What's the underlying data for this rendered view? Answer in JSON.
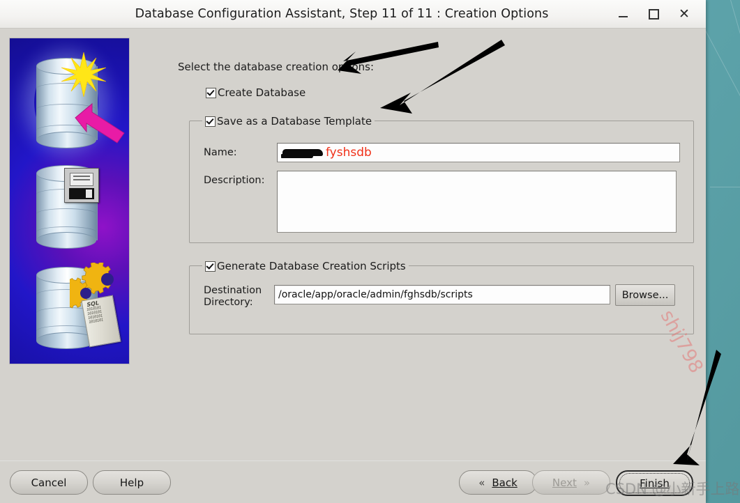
{
  "window": {
    "title": "Database Configuration Assistant, Step 11 of 11 : Creation Options",
    "minimize_label": "Minimize",
    "maximize_label": "Maximize",
    "close_label": "Close",
    "bg_color": "#d4d2cd",
    "titlebar_color": "#f4f3f1"
  },
  "desktop": {
    "bg_color": "#5aa3ac"
  },
  "sidepanel": {
    "alt": "Oracle database creation illustration",
    "scroll_label": "SQL",
    "scroll_bits_1": "1010101",
    "scroll_bits_2": "1010101",
    "scroll_bits_3": "1010101",
    "scroll_bits_4": "1010101"
  },
  "main": {
    "intro_text": "Select the database creation options:",
    "create_database": {
      "label": "Create Database",
      "checked": true
    },
    "save_template": {
      "label": "Save as a Database Template",
      "checked": true,
      "name_label": "Name:",
      "name_value": "fyshsdb",
      "name_redacted": true,
      "name_value_color": "#f03018",
      "description_label": "Description:",
      "description_value": ""
    },
    "generate_scripts": {
      "label": "Generate Database Creation Scripts",
      "checked": true,
      "destination_label_line1": "Destination",
      "destination_label_line2": "Directory:",
      "destination_value": "/oracle/app/oracle/admin/fghsdb/scripts",
      "browse_label": "Browse..."
    }
  },
  "buttons": {
    "cancel": {
      "label": "Cancel",
      "enabled": true
    },
    "help": {
      "label": "Help",
      "enabled": true
    },
    "back": {
      "label": "Back",
      "mnemonic": "B",
      "chevron": "«",
      "enabled": true
    },
    "next": {
      "label": "Next",
      "mnemonic": "N",
      "chevron": "»",
      "enabled": false
    },
    "finish": {
      "label": "Finish",
      "mnemonic": "F",
      "enabled": true,
      "focused": true
    }
  },
  "watermarks": {
    "csdn": "CSDN @小新手上路",
    "diagonal": "shij798"
  }
}
